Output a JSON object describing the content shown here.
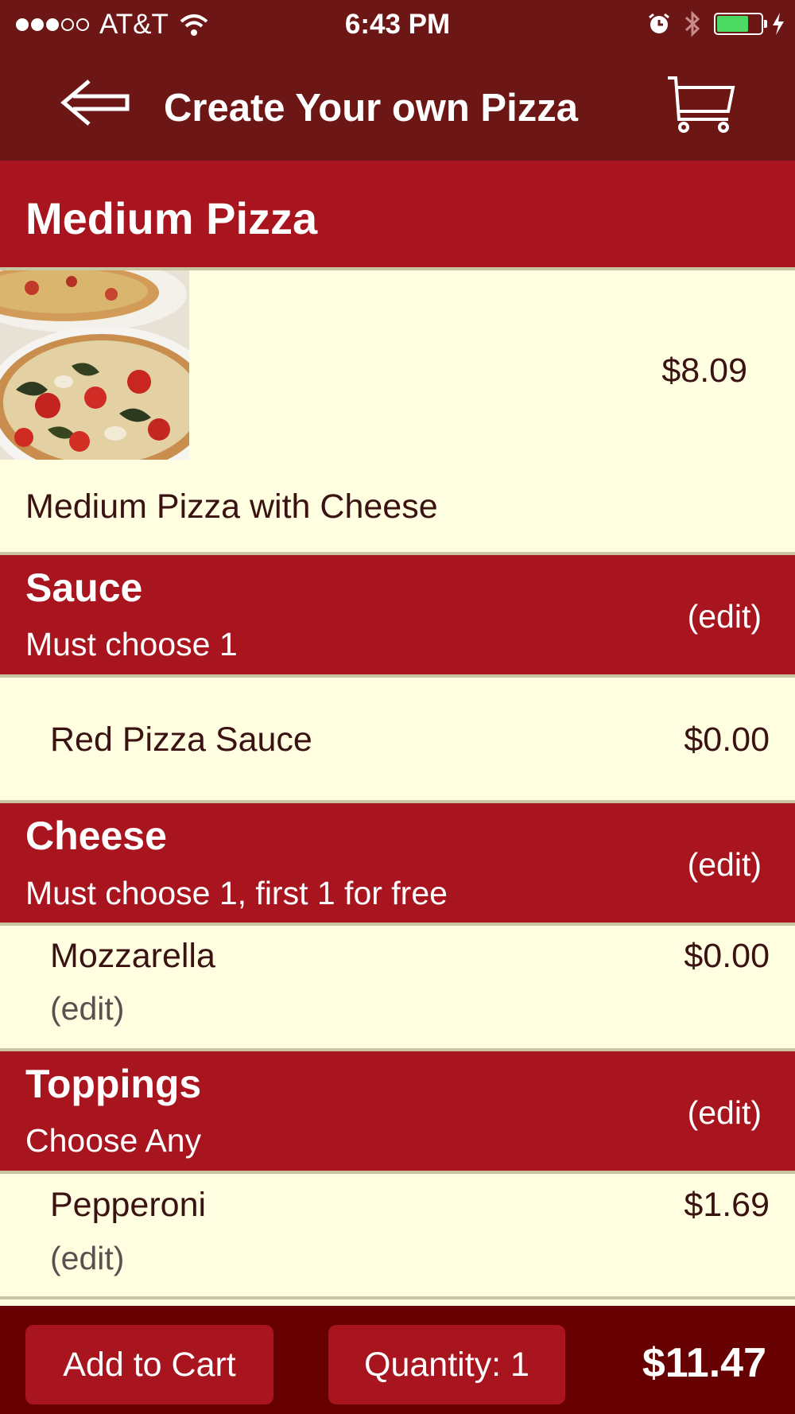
{
  "status_bar": {
    "carrier": "AT&T",
    "time": "6:43 PM",
    "signal_bars_filled": 3,
    "signal_bars_total": 5,
    "battery_level": 0.72
  },
  "nav": {
    "title": "Create Your own Pizza",
    "back_icon": "back-arrow-icon",
    "cart_icon": "shopping-cart-icon"
  },
  "product": {
    "title": "Medium Pizza",
    "price": "$8.09",
    "description": "Medium Pizza with Cheese"
  },
  "sections": [
    {
      "title": "Sauce",
      "subtitle": "Must choose 1",
      "edit_label": "(edit)",
      "items": [
        {
          "name": "Red Pizza Sauce",
          "price": "$0.00"
        }
      ]
    },
    {
      "title": "Cheese",
      "subtitle": "Must choose 1, first 1 for free",
      "edit_label": "(edit)",
      "items": [
        {
          "name": "Mozzarella",
          "price": "$0.00",
          "edit_label": "(edit)"
        }
      ]
    },
    {
      "title": "Toppings",
      "subtitle": "Choose Any",
      "edit_label": "(edit)",
      "items": [
        {
          "name": "Pepperoni",
          "price": "$1.69",
          "edit_label": "(edit)"
        }
      ]
    }
  ],
  "bottom_bar": {
    "add_to_cart_label": "Add to Cart",
    "quantity_label": "Quantity: 1",
    "total": "$11.47"
  },
  "colors": {
    "nav_background": "#6c1616",
    "section_header": "#a8151f",
    "content_background": "#fffee0",
    "bottom_bar": "#670000",
    "battery_fill": "#4cd964"
  }
}
